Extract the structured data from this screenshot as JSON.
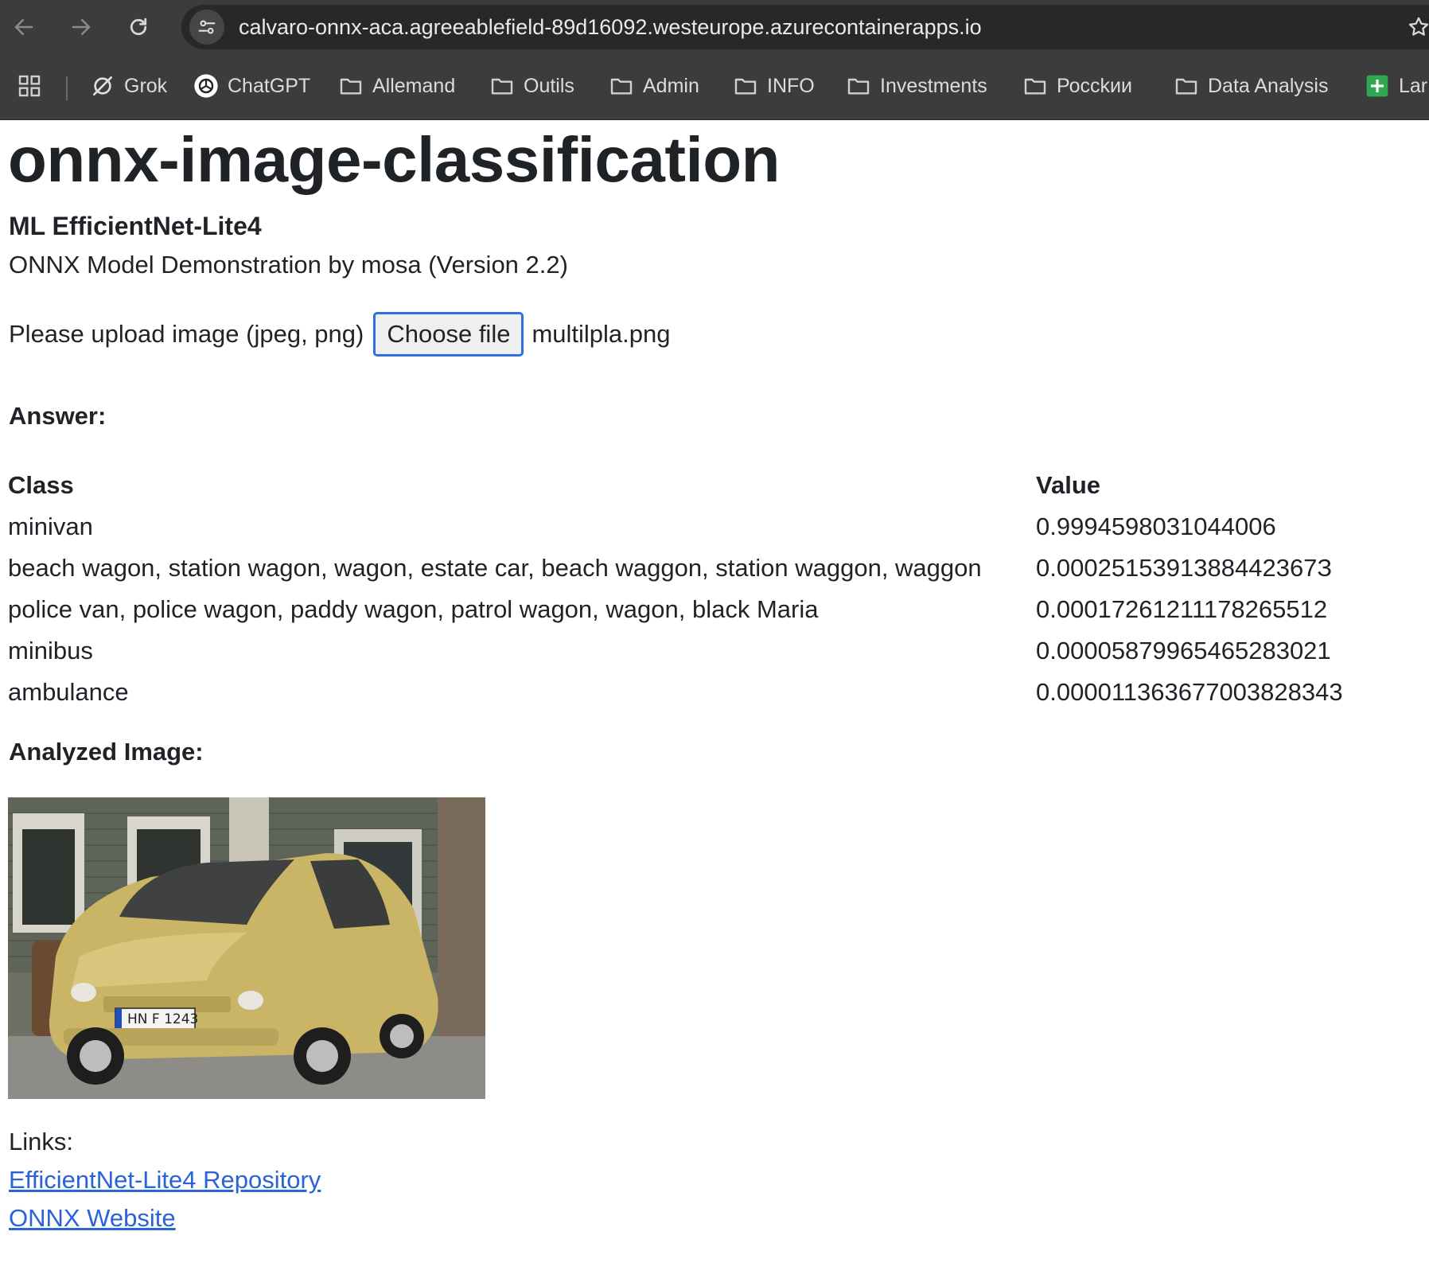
{
  "browser": {
    "url": "calvaro-onnx-aca.agreeablefield-89d16092.westeurope.azurecontainerapps.io",
    "bookmarks": [
      {
        "label": "Grok",
        "icon": "grok-icon"
      },
      {
        "label": "ChatGPT",
        "icon": "chatgpt-icon"
      },
      {
        "label": "Allemand",
        "icon": "folder-icon"
      },
      {
        "label": "Outils",
        "icon": "folder-icon"
      },
      {
        "label": "Admin",
        "icon": "folder-icon"
      },
      {
        "label": "INFO",
        "icon": "folder-icon"
      },
      {
        "label": "Investments",
        "icon": "folder-icon"
      },
      {
        "label": "Россkии",
        "icon": "folder-icon"
      },
      {
        "label": "Data Analysis",
        "icon": "folder-icon"
      },
      {
        "label": "Lar",
        "icon": "sheets-icon"
      }
    ]
  },
  "page": {
    "title": "onnx-image-classification",
    "subtitle": "ML EfficientNet-Lite4",
    "description": "ONNX Model Demonstration by mosa (Version 2.2)",
    "upload": {
      "label": "Please upload image (jpeg, png)",
      "button_label": "Choose file",
      "file_name": "multilpla.png"
    },
    "answer_label": "Answer:",
    "table": {
      "headers": [
        "Class",
        "Value"
      ],
      "rows": [
        {
          "class": "minivan",
          "value": "0.9994598031044006"
        },
        {
          "class": "beach wagon, station wagon, wagon, estate car, beach waggon, station waggon, waggon",
          "value": "0.0002515391388442367З"
        },
        {
          "class": "police van, police wagon, paddy wagon, patrol wagon, wagon, black Maria",
          "value": "0.00017261211178265512"
        },
        {
          "class": "minibus",
          "value": "0.00005879965465283021"
        },
        {
          "class": "ambulance",
          "value": "0.000011363677003828343"
        }
      ]
    },
    "analyzed_label": "Analyzed Image:",
    "plate_text": "HN F 1243",
    "links_label": "Links:",
    "links": [
      {
        "label": "EfficientNet-Lite4 Repository"
      },
      {
        "label": "ONNX Website"
      }
    ]
  },
  "colors": {
    "chrome": "#3c3c3c",
    "omnibox": "#282828",
    "link": "#2a62d8",
    "focus_border": "#2f6fe0",
    "car_body": "#c9b565"
  }
}
